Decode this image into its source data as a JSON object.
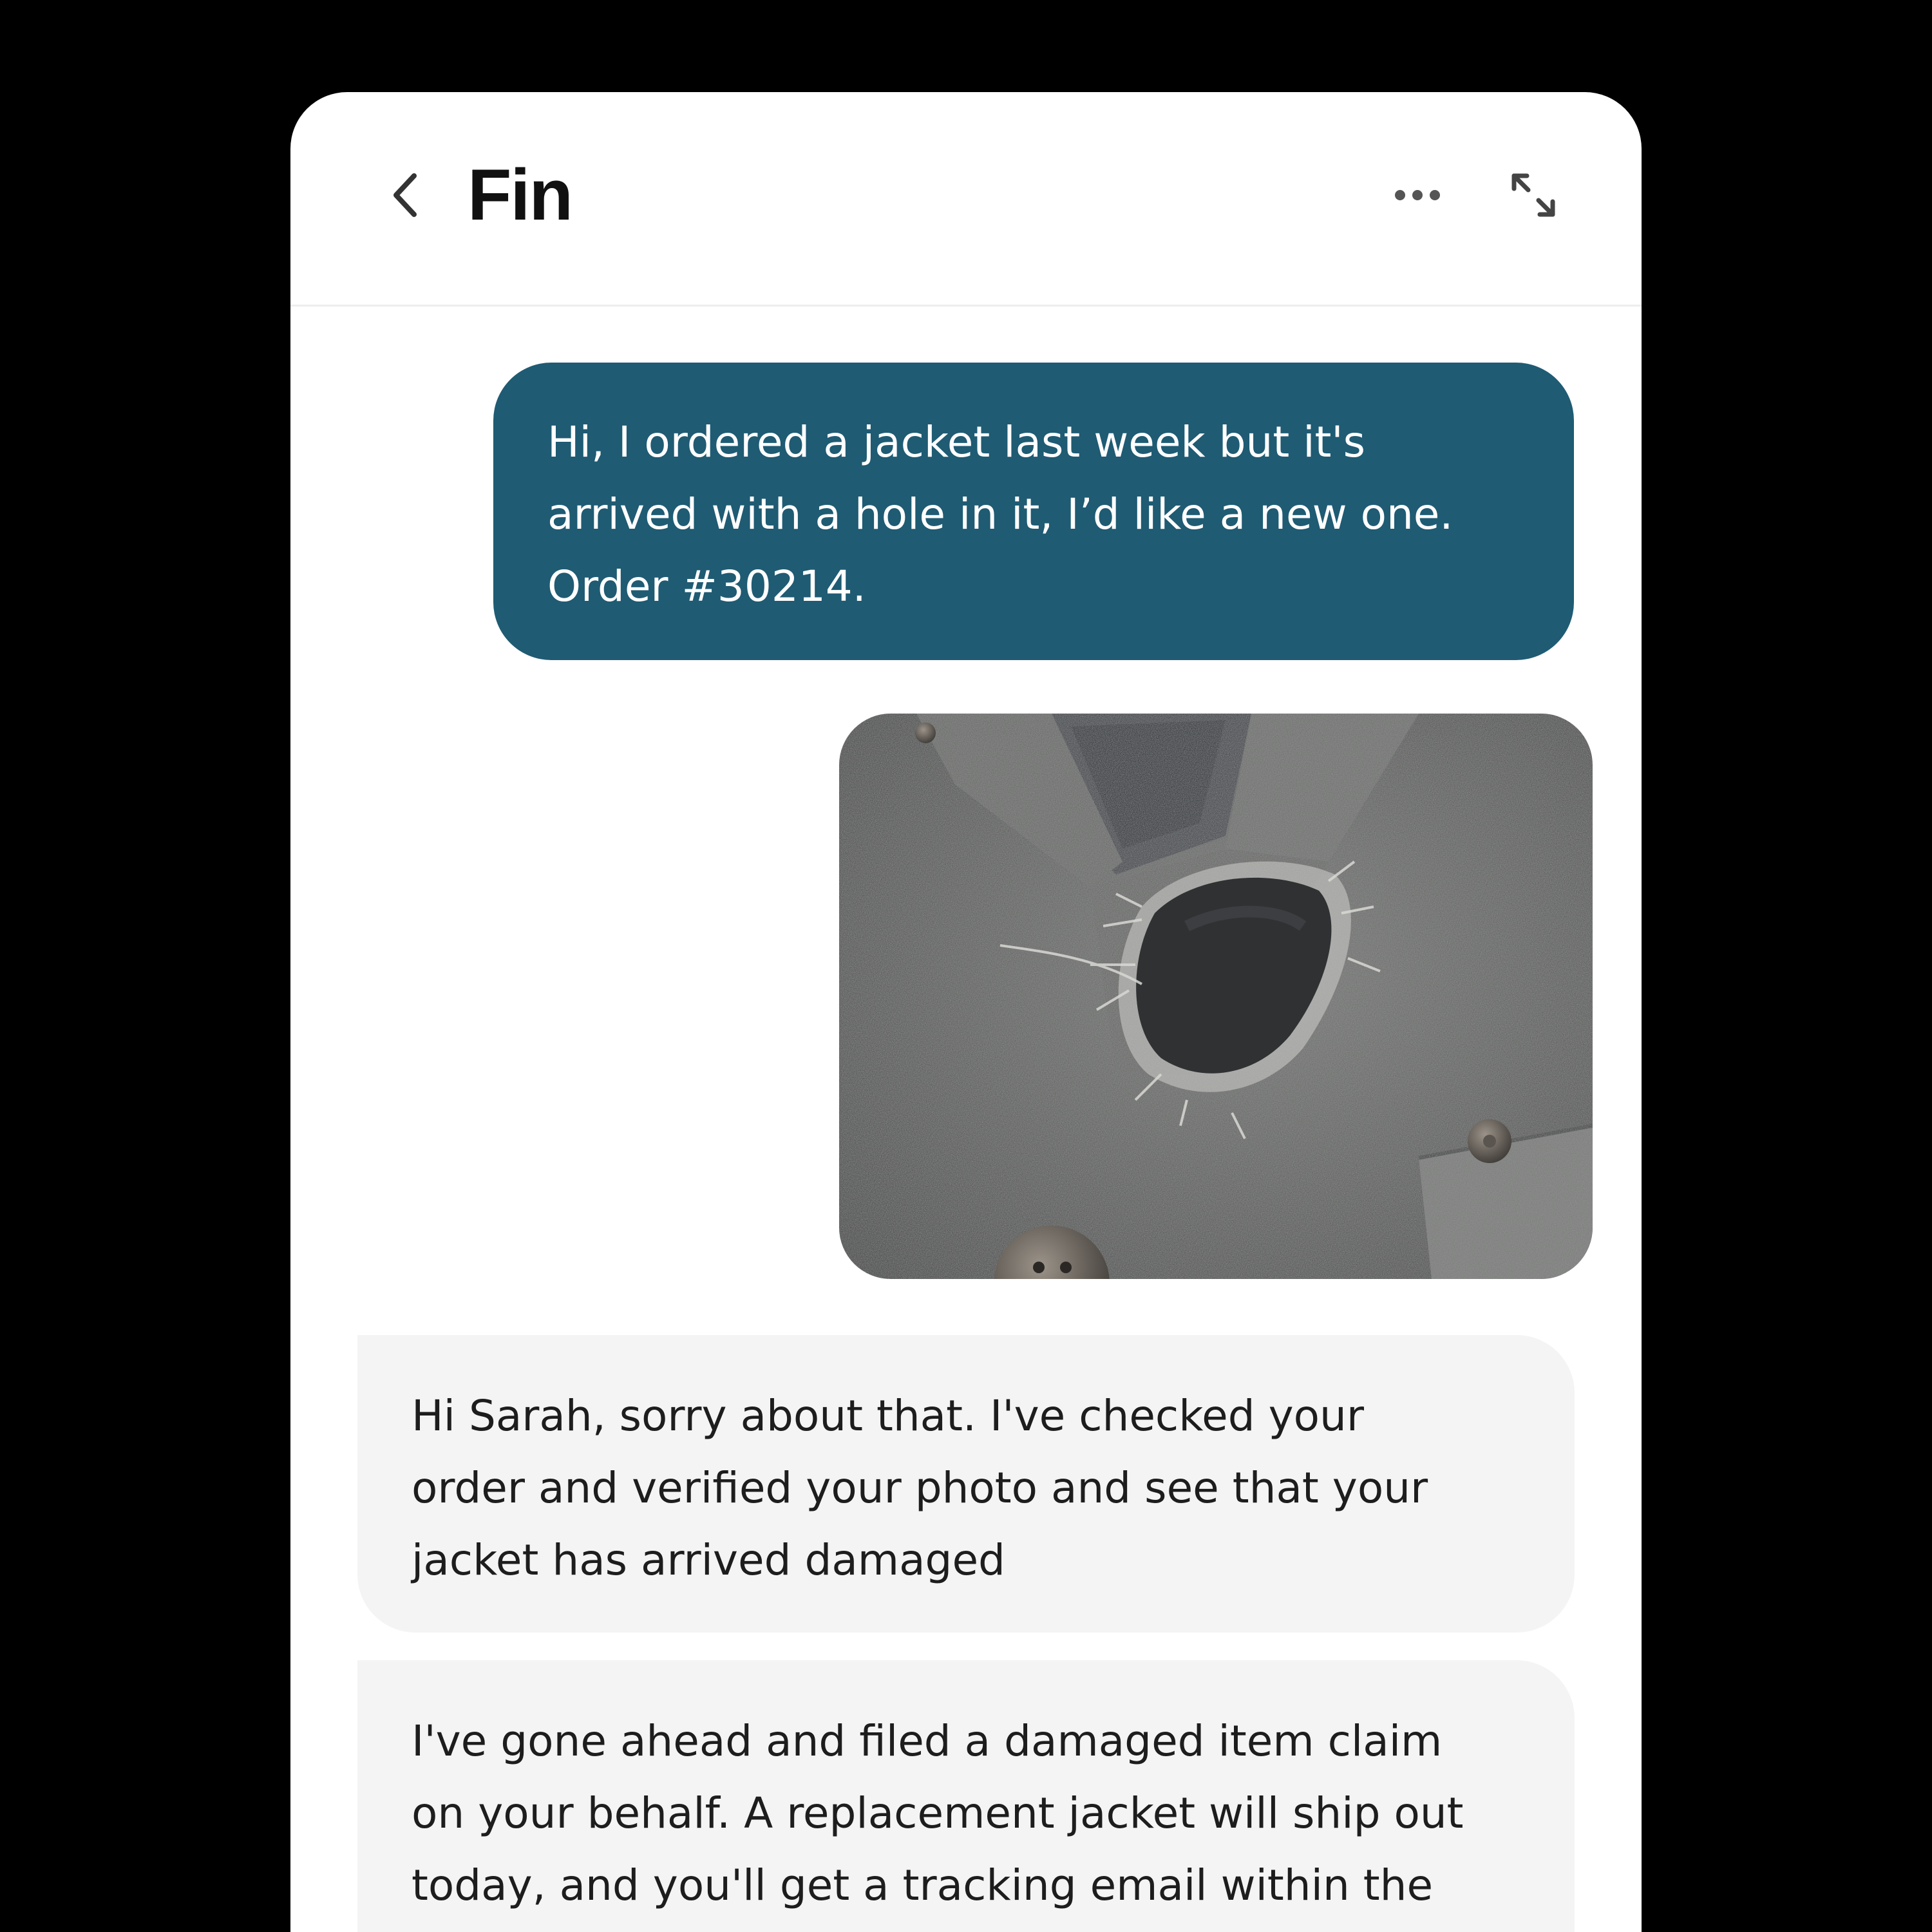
{
  "header": {
    "title": "Fin",
    "back_icon": "chevron-left-icon",
    "more_icon": "ellipsis-icon",
    "expand_icon": "expand-arrows-icon"
  },
  "messages": [
    {
      "from": "user",
      "lines": [
        "Hi, I ordered a jacket last week but it's",
        "arrived with a hole in it, I’d like a new one.",
        "Order #30214."
      ]
    },
    {
      "from": "user",
      "attachment": "photo"
    },
    {
      "from": "bot",
      "lines": [
        "Hi Sarah, sorry about that. I've checked your",
        "order and verified your photo and see that your",
        "jacket has arrived damaged"
      ]
    },
    {
      "from": "bot",
      "lines": [
        "I've gone ahead and filed a damaged item claim",
        "on your behalf. A replacement jacket will ship out",
        "today, and you'll get a tracking email within the"
      ]
    }
  ],
  "colors": {
    "user_bubble": "#1f5b73",
    "bot_bubble": "#f4f4f4",
    "background": "#000000"
  }
}
